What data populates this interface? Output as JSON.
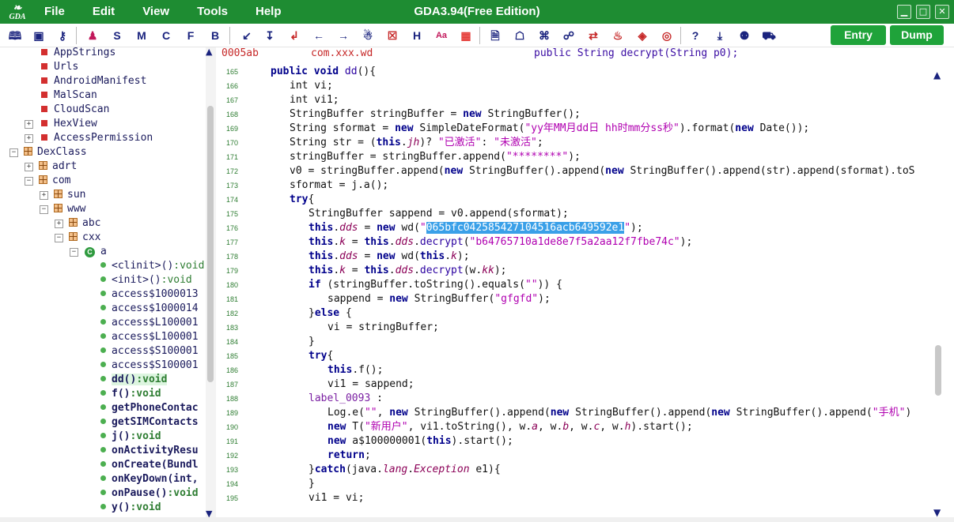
{
  "window": {
    "title": "GDA3.94(Free Edition)",
    "logo": "GDA"
  },
  "menu": [
    "File",
    "Edit",
    "View",
    "Tools",
    "Help"
  ],
  "toolbar": {
    "letters": [
      "S",
      "M",
      "C",
      "F",
      "B"
    ],
    "entry_label": "Entry",
    "dump_label": "Dump"
  },
  "tree": [
    {
      "label": "AppStrings",
      "kind": "red",
      "indent": 0
    },
    {
      "label": "Urls",
      "kind": "red",
      "indent": 0
    },
    {
      "label": "AndroidManifest",
      "kind": "red",
      "indent": 0
    },
    {
      "label": "MalScan",
      "kind": "red",
      "indent": 0
    },
    {
      "label": "CloudScan",
      "kind": "red",
      "indent": 0
    },
    {
      "label": "HexView",
      "kind": "red",
      "indent": 0,
      "exp": "+"
    },
    {
      "label": "AccessPermission",
      "kind": "red",
      "indent": 0,
      "exp": "+"
    },
    {
      "label": "DexClass",
      "kind": "pkg",
      "indent": 0,
      "exp": "-",
      "root": true
    },
    {
      "label": "adrt",
      "kind": "pkg",
      "indent": 1,
      "exp": "+"
    },
    {
      "label": "com",
      "kind": "pkg",
      "indent": 1,
      "exp": "-"
    },
    {
      "label": "sun",
      "kind": "pkg",
      "indent": 2,
      "exp": "+"
    },
    {
      "label": "www",
      "kind": "pkg",
      "indent": 2,
      "exp": "-"
    },
    {
      "label": "abc",
      "kind": "pkg",
      "indent": 3,
      "exp": "+"
    },
    {
      "label": "cxx",
      "kind": "pkg",
      "indent": 3,
      "exp": "-"
    },
    {
      "label": "a",
      "kind": "cls",
      "indent": 4,
      "exp": "-"
    },
    {
      "name": "<clinit>()",
      "ret": ":void",
      "kind": "m",
      "indent": 5
    },
    {
      "name": "<init>()",
      "ret": ":void",
      "kind": "m",
      "indent": 5
    },
    {
      "name": "access$1000013",
      "kind": "m",
      "indent": 5
    },
    {
      "name": "access$1000014",
      "kind": "m",
      "indent": 5
    },
    {
      "name": "access$L100001",
      "kind": "m",
      "indent": 5
    },
    {
      "name": "access$L100001",
      "kind": "m",
      "indent": 5
    },
    {
      "name": "access$S100001",
      "kind": "m",
      "indent": 5
    },
    {
      "name": "access$S100001",
      "kind": "m",
      "indent": 5
    },
    {
      "name": "dd()",
      "ret": ":void",
      "kind": "m",
      "bold": true,
      "sel": true,
      "indent": 5
    },
    {
      "name": "f()",
      "ret": ":void",
      "kind": "m",
      "bold": true,
      "indent": 5
    },
    {
      "name": "getPhoneContac",
      "kind": "m",
      "bold": true,
      "indent": 5
    },
    {
      "name": "getSIMContacts",
      "kind": "m",
      "bold": true,
      "indent": 5
    },
    {
      "name": "j()",
      "ret": ":void",
      "kind": "m",
      "bold": true,
      "indent": 5
    },
    {
      "name": "onActivityResu",
      "kind": "m",
      "bold": true,
      "indent": 5
    },
    {
      "name": "onCreate(Bundl",
      "kind": "m",
      "bold": true,
      "indent": 5
    },
    {
      "name": "onKeyDown(int,",
      "kind": "m",
      "bold": true,
      "indent": 5
    },
    {
      "name": "onPause()",
      "ret": ":void",
      "kind": "m",
      "bold": true,
      "indent": 5
    },
    {
      "name": "y()",
      "ret": ":void",
      "kind": "m",
      "bold": true,
      "indent": 5
    }
  ],
  "header": {
    "offset": "0005ab",
    "package": "com.xxx.wd",
    "signature": "public String decrypt(String p0);"
  },
  "code": [
    {
      "n": "165",
      "t": [
        [
          "k",
          "public void "
        ],
        [
          "dk",
          "dd"
        ],
        [
          "",
          "(){"
        ]
      ],
      "i": 0
    },
    {
      "n": "166",
      "t": [
        [
          "",
          "int vi;"
        ]
      ],
      "i": 1
    },
    {
      "n": "167",
      "t": [
        [
          "",
          "int vi1;"
        ]
      ],
      "i": 1
    },
    {
      "n": "168",
      "t": [
        [
          "",
          "StringBuffer stringBuffer = "
        ],
        [
          "k",
          "new"
        ],
        [
          "",
          " StringBuffer();"
        ]
      ],
      "i": 1
    },
    {
      "n": "169",
      "t": [
        [
          "",
          "String sformat = "
        ],
        [
          "k",
          "new"
        ],
        [
          "",
          " SimpleDateFormat("
        ],
        [
          "s",
          "\"yy年MM月dd日 hh时mm分ss秒\""
        ],
        [
          "",
          ").format("
        ],
        [
          "k",
          "new"
        ],
        [
          "",
          " Date());"
        ]
      ],
      "i": 1
    },
    {
      "n": "170",
      "t": [
        [
          "",
          "String str = ("
        ],
        [
          "k",
          "this"
        ],
        [
          "",
          "."
        ],
        [
          "f",
          "jh"
        ],
        [
          "",
          ")? "
        ],
        [
          "s",
          "\"已激活\""
        ],
        [
          "",
          ": "
        ],
        [
          "s",
          "\"未激活\""
        ],
        [
          "",
          ";"
        ]
      ],
      "i": 1
    },
    {
      "n": "171",
      "t": [
        [
          "",
          "stringBuffer = stringBuffer.append("
        ],
        [
          "s",
          "\"********\""
        ],
        [
          "",
          ");"
        ]
      ],
      "i": 1
    },
    {
      "n": "172",
      "t": [
        [
          "",
          "v0 = stringBuffer.append("
        ],
        [
          "k",
          "new"
        ],
        [
          "",
          " StringBuffer().append("
        ],
        [
          "k",
          "new"
        ],
        [
          "",
          " StringBuffer().append(str).append(sformat).toS"
        ]
      ],
      "i": 1
    },
    {
      "n": "173",
      "t": [
        [
          "",
          "sformat = j.a();"
        ]
      ],
      "i": 1
    },
    {
      "n": "174",
      "t": [
        [
          "k",
          "try"
        ],
        [
          "",
          "{"
        ]
      ],
      "i": 1
    },
    {
      "n": "175",
      "t": [
        [
          "",
          "StringBuffer sappend = v0.append(sformat);"
        ]
      ],
      "i": 2
    },
    {
      "n": "176",
      "t": [
        [
          "k",
          "this"
        ],
        [
          "",
          "."
        ],
        [
          "f",
          "dds"
        ],
        [
          "",
          " = "
        ],
        [
          "k",
          "new"
        ],
        [
          "",
          " wd("
        ],
        [
          "s",
          "\""
        ],
        [
          "sel",
          "065bfc042585427104516acb649592e1"
        ],
        [
          "s",
          "\""
        ],
        [
          "",
          ");"
        ]
      ],
      "i": 2
    },
    {
      "n": "177",
      "t": [
        [
          "k",
          "this"
        ],
        [
          "",
          "."
        ],
        [
          "f",
          "k"
        ],
        [
          "",
          " = "
        ],
        [
          "k",
          "this"
        ],
        [
          "",
          "."
        ],
        [
          "f",
          "dds"
        ],
        [
          "",
          "."
        ],
        [
          "dk",
          "decrypt"
        ],
        [
          "",
          "("
        ],
        [
          "s",
          "\"b64765710a1de8e7f5a2aa12f7fbe74c\""
        ],
        [
          "",
          ");"
        ]
      ],
      "i": 2
    },
    {
      "n": "178",
      "t": [
        [
          "k",
          "this"
        ],
        [
          "",
          "."
        ],
        [
          "f",
          "dds"
        ],
        [
          "",
          " = "
        ],
        [
          "k",
          "new"
        ],
        [
          "",
          " wd("
        ],
        [
          "k",
          "this"
        ],
        [
          "",
          "."
        ],
        [
          "f",
          "k"
        ],
        [
          "",
          ");"
        ]
      ],
      "i": 2
    },
    {
      "n": "179",
      "t": [
        [
          "k",
          "this"
        ],
        [
          "",
          "."
        ],
        [
          "f",
          "k"
        ],
        [
          "",
          " = "
        ],
        [
          "k",
          "this"
        ],
        [
          "",
          "."
        ],
        [
          "f",
          "dds"
        ],
        [
          "",
          "."
        ],
        [
          "dk",
          "decrypt"
        ],
        [
          "",
          "(w."
        ],
        [
          "f",
          "kk"
        ],
        [
          "",
          ");"
        ]
      ],
      "i": 2
    },
    {
      "n": "180",
      "t": [
        [
          "k",
          "if"
        ],
        [
          "",
          " (stringBuffer.toString().equals("
        ],
        [
          "s",
          "\"\""
        ],
        [
          "",
          ")) {"
        ]
      ],
      "i": 2
    },
    {
      "n": "181",
      "t": [
        [
          "",
          "sappend = "
        ],
        [
          "k",
          "new"
        ],
        [
          "",
          " StringBuffer("
        ],
        [
          "s",
          "\"gfgfd\""
        ],
        [
          "",
          ");"
        ]
      ],
      "i": 3
    },
    {
      "n": "182",
      "t": [
        [
          "",
          "}"
        ],
        [
          "k",
          "else"
        ],
        [
          "",
          " {"
        ]
      ],
      "i": 2
    },
    {
      "n": "183",
      "t": [
        [
          "",
          "vi = stringBuffer;"
        ]
      ],
      "i": 3
    },
    {
      "n": "184",
      "t": [
        [
          "",
          "}"
        ]
      ],
      "i": 2
    },
    {
      "n": "185",
      "t": [
        [
          "k",
          "try"
        ],
        [
          "",
          "{"
        ]
      ],
      "i": 2
    },
    {
      "n": "186",
      "t": [
        [
          "k",
          "this"
        ],
        [
          "",
          ".f();"
        ]
      ],
      "i": 3
    },
    {
      "n": "187",
      "t": [
        [
          "",
          "vi1 = sappend;"
        ]
      ],
      "i": 3
    },
    {
      "n": "188",
      "t": [
        [
          "lb",
          "label_0093"
        ],
        [
          "",
          " :"
        ]
      ],
      "i": 2
    },
    {
      "n": "189",
      "t": [
        [
          "",
          "Log.e("
        ],
        [
          "s",
          "\"\""
        ],
        [
          "",
          ", "
        ],
        [
          "k",
          "new"
        ],
        [
          "",
          " StringBuffer().append("
        ],
        [
          "k",
          "new"
        ],
        [
          "",
          " StringBuffer().append("
        ],
        [
          "k",
          "new"
        ],
        [
          "",
          " StringBuffer().append("
        ],
        [
          "s",
          "\"手机\""
        ],
        [
          "",
          ")"
        ]
      ],
      "i": 3
    },
    {
      "n": "190",
      "t": [
        [
          "k",
          "new"
        ],
        [
          "",
          " T("
        ],
        [
          "s",
          "\"新用户\""
        ],
        [
          "",
          ", vi1.toString(), w."
        ],
        [
          "f",
          "a"
        ],
        [
          "",
          ", w."
        ],
        [
          "f",
          "b"
        ],
        [
          "",
          ", w."
        ],
        [
          "f",
          "c"
        ],
        [
          "",
          ", w."
        ],
        [
          "f",
          "h"
        ],
        [
          "",
          ").start();"
        ]
      ],
      "i": 3
    },
    {
      "n": "191",
      "t": [
        [
          "k",
          "new"
        ],
        [
          "",
          " a$100000001("
        ],
        [
          "k",
          "this"
        ],
        [
          "",
          ").start();"
        ]
      ],
      "i": 3
    },
    {
      "n": "192",
      "t": [
        [
          "k",
          "return"
        ],
        [
          "",
          ";"
        ]
      ],
      "i": 3
    },
    {
      "n": "193",
      "t": [
        [
          "",
          "}"
        ],
        [
          "k",
          "catch"
        ],
        [
          "",
          "(java."
        ],
        [
          "f",
          "lang"
        ],
        [
          "",
          "."
        ],
        [
          "f",
          "Exception"
        ],
        [
          "",
          " e1){"
        ]
      ],
      "i": 2
    },
    {
      "n": "194",
      "t": [
        [
          "",
          "}"
        ]
      ],
      "i": 2
    },
    {
      "n": "195",
      "t": [
        [
          "",
          "vi1 = vi;"
        ]
      ],
      "i": 2
    }
  ]
}
